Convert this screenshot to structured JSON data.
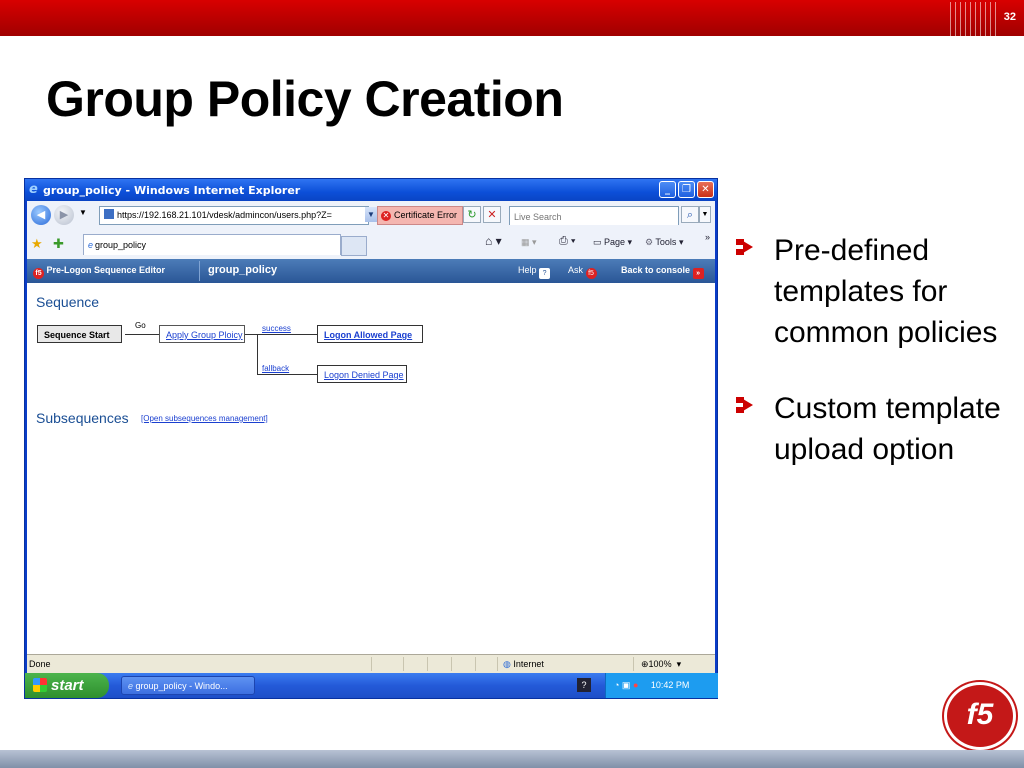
{
  "slide": {
    "number": "32",
    "title": "Group Policy Creation",
    "bullets": [
      "Pre-defined templates for common policies",
      "Custom template upload option"
    ],
    "logo_text": "f5",
    "colors": {
      "brand_red": "#c00000",
      "link_blue": "#1a3fd0",
      "heading_blue": "#1a4e94"
    }
  },
  "browser": {
    "window_title": "group_policy - Windows Internet Explorer",
    "address": "https://192.168.21.101/vdesk/admincon/users.php?Z=",
    "cert_error": "Certificate Error",
    "search_placeholder": "Live Search",
    "tab_title": "group_policy",
    "toolbar": {
      "page": "Page",
      "tools": "Tools"
    }
  },
  "app": {
    "editor_label": "Pre-Logon Sequence Editor",
    "policy_name": "group_policy",
    "help": "Help",
    "ask": "Ask",
    "back": "Back to console",
    "sequence_heading": "Sequence",
    "start_node": "Sequence Start",
    "go_label": "Go",
    "action_node": "Apply Group Ploicy",
    "success_label": "success",
    "fallback_label": "fallback",
    "allowed_node": "Logon Allowed Page",
    "denied_node": "Logon Denied Page",
    "subsequences_heading": "Subsequences",
    "subsequences_link": "[Open subsequences management]"
  },
  "statusbar": {
    "status": "Done",
    "zone": "Internet",
    "zoom": "100%"
  },
  "taskbar": {
    "start": "start",
    "item": "group_policy - Windo...",
    "time": "10:42 PM"
  }
}
